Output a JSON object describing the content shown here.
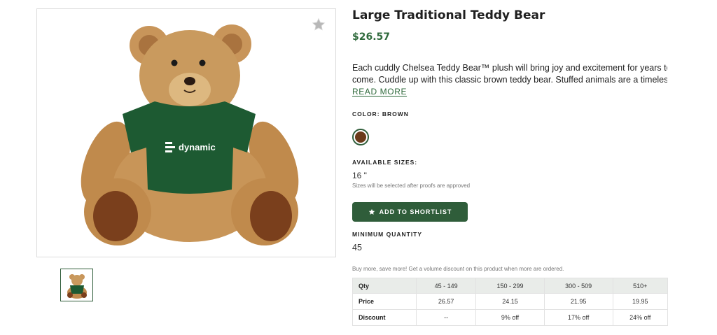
{
  "product": {
    "title": "Large Traditional Teddy Bear",
    "price": "$26.57",
    "description_lines": [
      "Each cuddly Chelsea Teddy Bear™ plush will bring joy and excitement for years to",
      "come. Cuddle up with this classic brown teddy bear. Stuffed animals are a timeless..."
    ],
    "read_more": "READ MORE",
    "image_logo_text": "dynamic"
  },
  "color": {
    "label": "COLOR: BROWN",
    "swatch_hex": "#6b3a1a"
  },
  "sizes": {
    "label": "AVAILABLE SIZES:",
    "value": "16 \"",
    "note": "Sizes will be selected after proofs are approved"
  },
  "actions": {
    "shortlist_label": "ADD TO SHORTLIST"
  },
  "minimum_quantity": {
    "label": "MINIMUM QUANTITY",
    "value": "45"
  },
  "volume": {
    "note": "Buy more, save more! Get a volume discount on this product when more are ordered.",
    "table": {
      "header": [
        "Qty",
        "45 - 149",
        "150 - 299",
        "300 - 509",
        "510+"
      ],
      "rows": [
        [
          "Price",
          "26.57",
          "24.15",
          "21.95",
          "19.95"
        ],
        [
          "Discount",
          "--",
          "9% off",
          "17% off",
          "24% off"
        ]
      ]
    }
  },
  "colors": {
    "brand_green": "#2f5d3a",
    "price_green": "#2f6a3c",
    "shirt_green": "#1d5a32",
    "bear_tan": "#c08a4c"
  },
  "icons": {
    "favorite": "star-icon",
    "shortlist": "star-icon"
  }
}
